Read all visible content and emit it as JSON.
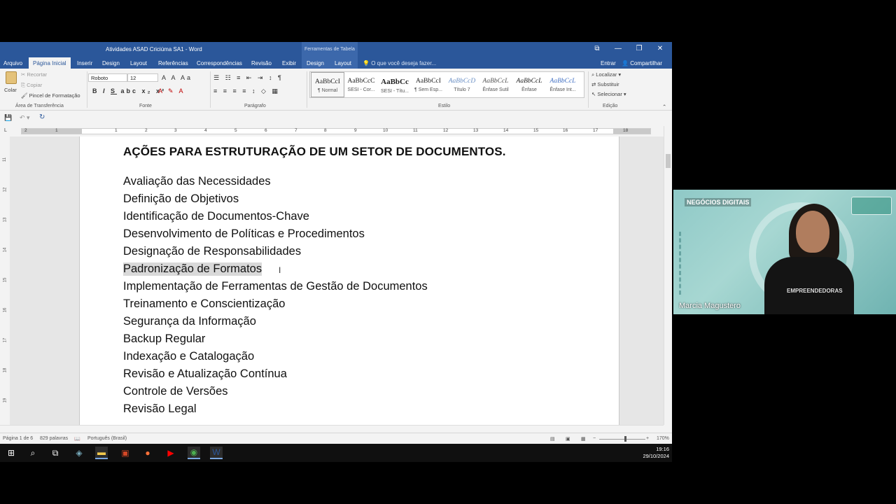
{
  "window": {
    "title": "Atividades ASAD Criciúma SA1 - Word",
    "context_title": "Ferramentas de Tabela",
    "controls": [
      "⧉",
      "—",
      "❐",
      "✕"
    ]
  },
  "tabs": {
    "items": [
      "Arquivo",
      "Página Inicial",
      "Inserir",
      "Design",
      "Layout",
      "Referências",
      "Correspondências",
      "Revisão",
      "Exibir"
    ],
    "context_items": [
      "Design",
      "Layout"
    ],
    "tell_me": "O que você deseja fazer...",
    "signin": "Entrar",
    "share": "Compartilhar"
  },
  "ribbon": {
    "clipboard": {
      "paste": "Colar",
      "cut": "Recortar",
      "copy": "Copiar",
      "format_painter": "Pincel de Formatação",
      "label": "Área de Transferência"
    },
    "font": {
      "name": "Roboto",
      "size": "12",
      "label": "Fonte"
    },
    "paragraph": {
      "label": "Parágrafo"
    },
    "styles": {
      "label": "Estilo",
      "items": [
        {
          "preview": "AaBbCcI",
          "name": "¶ Normal"
        },
        {
          "preview": "AaBbCcC",
          "name": "SESI - Cor..."
        },
        {
          "preview": "AaBbCc",
          "name": "SESI - Títu..."
        },
        {
          "preview": "AaBbCcI",
          "name": "¶ Sem Esp..."
        },
        {
          "preview": "AaBbCcD",
          "name": "Título 7"
        },
        {
          "preview": "AaBbCcL",
          "name": "Ênfase Sutil"
        },
        {
          "preview": "AaBbCcL",
          "name": "Ênfase"
        },
        {
          "preview": "AaBbCcL",
          "name": "Ênfase Int..."
        }
      ]
    },
    "editing": {
      "find": "Localizar",
      "replace": "Substituir",
      "select": "Selecionar",
      "label": "Edição"
    }
  },
  "ruler": {
    "ticks": [
      "2",
      "1",
      "1",
      "2",
      "3",
      "4",
      "5",
      "6",
      "7",
      "8",
      "9",
      "10",
      "11",
      "12",
      "13",
      "14",
      "15",
      "16",
      "17",
      "18"
    ],
    "vticks": [
      "11",
      "12",
      "13",
      "14",
      "15",
      "16",
      "17",
      "18",
      "19"
    ]
  },
  "document": {
    "heading": "AÇÕES PARA ESTRUTURAÇÃO DE UM SETOR DE DOCUMENTOS.",
    "items": [
      "Avaliação das Necessidades",
      "Definição de Objetivos",
      "Identificação de Documentos-Chave",
      "Desenvolvimento de Políticas e Procedimentos",
      "Designação de Responsabilidades",
      "Padronização de Formatos",
      "Implementação de Ferramentas de Gestão de Documentos",
      "Treinamento e Conscientização",
      "Segurança da Informação",
      "Backup Regular",
      "Indexação e Catalogação",
      "Revisão e Atualização Contínua",
      "Controle de Versões",
      "Revisão Legal"
    ],
    "selected_index": 5
  },
  "status": {
    "page": "Página 1 de 6",
    "words": "829 palavras",
    "language": "Português (Brasil)",
    "zoom": "170%"
  },
  "taskbar": {
    "time": "19:16",
    "date": "29/10/2024"
  },
  "video": {
    "badge_prefix": "NEGÓCIOS",
    "badge_strong": "DIGITAIS",
    "participant": "Marcia Magustero",
    "shirt_text": "EMPREENDEDORAS"
  }
}
